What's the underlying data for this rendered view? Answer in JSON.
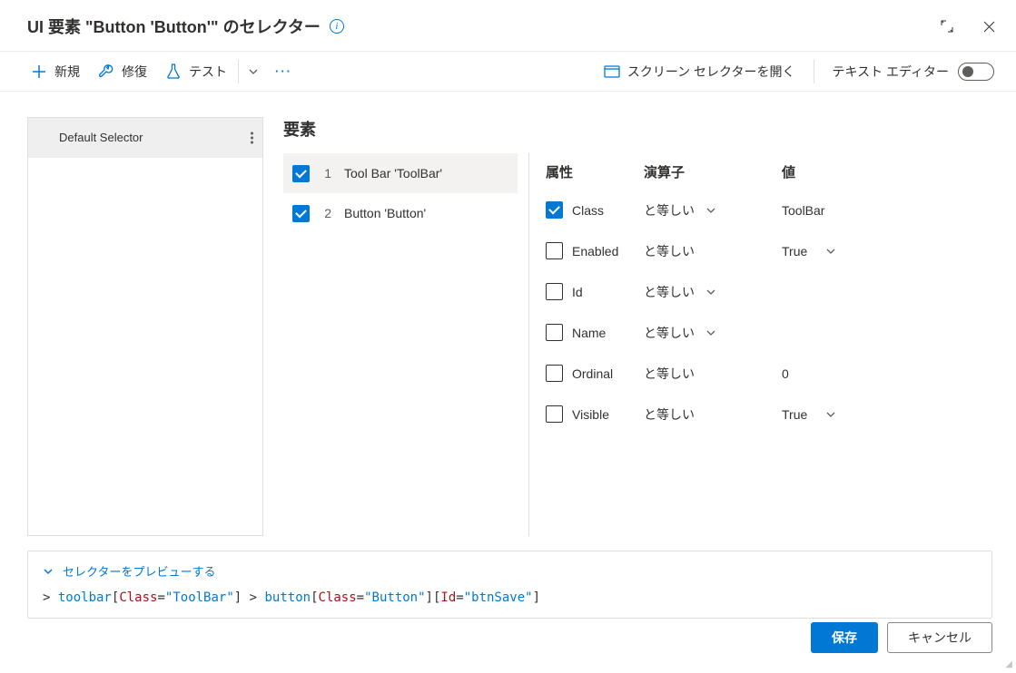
{
  "title": "UI 要素 \"Button 'Button'\" のセレクター",
  "toolbar": {
    "new": "新規",
    "repair": "修復",
    "test": "テスト",
    "screen_selector": "スクリーン セレクターを開く",
    "text_editor": "テキスト エディター"
  },
  "selectors": {
    "items": [
      {
        "label": "Default Selector"
      }
    ]
  },
  "elements": {
    "title": "要素",
    "items": [
      {
        "num": "1",
        "label": "Tool Bar 'ToolBar'",
        "checked": true,
        "selected": true
      },
      {
        "num": "2",
        "label": "Button 'Button'",
        "checked": true,
        "selected": false
      }
    ]
  },
  "attrs": {
    "head": {
      "c1": "属性",
      "c2": "演算子",
      "c3": "値"
    },
    "rows": [
      {
        "checked": true,
        "name": "Class",
        "op": "と等しい",
        "val": "ToolBar",
        "valdd": false,
        "opdd": true
      },
      {
        "checked": false,
        "name": "Enabled",
        "op": "と等しい",
        "val": "True",
        "valdd": true,
        "opdd": false
      },
      {
        "checked": false,
        "name": "Id",
        "op": "と等しい",
        "val": "",
        "valdd": false,
        "opdd": true
      },
      {
        "checked": false,
        "name": "Name",
        "op": "と等しい",
        "val": "",
        "valdd": false,
        "opdd": true
      },
      {
        "checked": false,
        "name": "Ordinal",
        "op": "と等しい",
        "val": "0",
        "valdd": false,
        "opdd": false
      },
      {
        "checked": false,
        "name": "Visible",
        "op": "と等しい",
        "val": "True",
        "valdd": true,
        "opdd": false
      }
    ]
  },
  "preview": {
    "label": "セレクターをプレビューする",
    "tokens": [
      {
        "t": "gt",
        "v": "> "
      },
      {
        "t": "tag",
        "v": "toolbar"
      },
      {
        "t": "br",
        "v": "["
      },
      {
        "t": "attr",
        "v": "Class"
      },
      {
        "t": "eq",
        "v": "="
      },
      {
        "t": "val",
        "v": "\"ToolBar\""
      },
      {
        "t": "br",
        "v": "]"
      },
      {
        "t": "gt",
        "v": " > "
      },
      {
        "t": "tag",
        "v": "button"
      },
      {
        "t": "br",
        "v": "["
      },
      {
        "t": "attr",
        "v": "Class"
      },
      {
        "t": "eq",
        "v": "="
      },
      {
        "t": "val",
        "v": "\"Button\""
      },
      {
        "t": "br",
        "v": "]"
      },
      {
        "t": "br",
        "v": "["
      },
      {
        "t": "attr",
        "v": "Id"
      },
      {
        "t": "eq",
        "v": "="
      },
      {
        "t": "val",
        "v": "\"btnSave\""
      },
      {
        "t": "br",
        "v": "]"
      }
    ]
  },
  "footer": {
    "save": "保存",
    "cancel": "キャンセル"
  }
}
